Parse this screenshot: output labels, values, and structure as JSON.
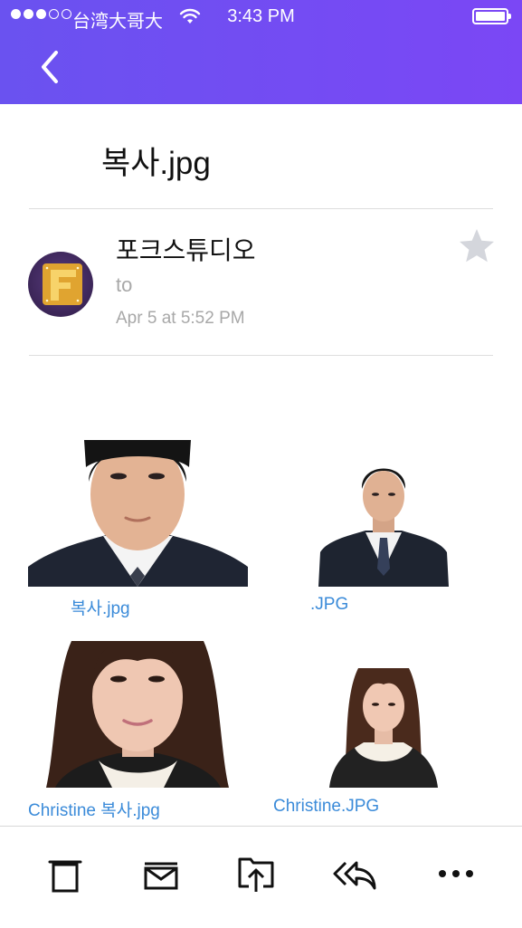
{
  "status_bar": {
    "carrier": "台湾大哥大",
    "time": "3:43 PM"
  },
  "nav": {
    "back_icon": "chevron-left-icon"
  },
  "email": {
    "subject": "복사.jpg",
    "sender_name": "포크스튜디오",
    "to_line": "to",
    "date": "Apr 5 at 5:52 PM",
    "avatar_letter": "F"
  },
  "attachments": [
    {
      "filename": "복사.jpg"
    },
    {
      "filename": ".JPG"
    },
    {
      "filename": "Christine 복사.jpg"
    },
    {
      "filename": "Christine.JPG"
    }
  ],
  "toolbar": {
    "items": [
      "trash-icon",
      "archive-icon",
      "move-icon",
      "reply-all-icon",
      "more-icon"
    ]
  },
  "colors": {
    "header_gradient_start": "#6a52f0",
    "header_gradient_end": "#7b47f5",
    "link_blue": "#3b8bd9",
    "muted_gray": "#a8a8a8"
  }
}
